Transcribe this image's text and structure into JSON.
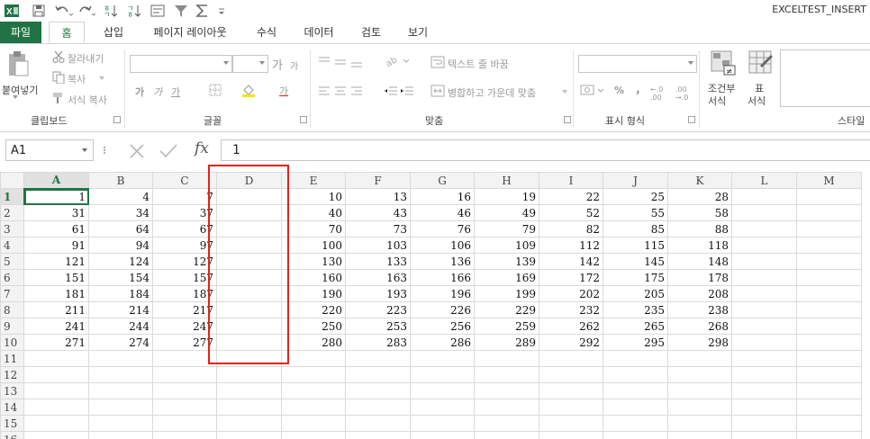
{
  "window": {
    "title": "EXCELTEST_INSERT"
  },
  "quick_access": {
    "icons": [
      "excel-logo-icon",
      "save-icon",
      "undo-icon",
      "redo-icon",
      "sort-ascending-icon",
      "sort-descending-icon",
      "form-icon",
      "filter-icon",
      "autosum-icon",
      "customize-icon"
    ]
  },
  "tabs": [
    {
      "label": "파일"
    },
    {
      "label": "홈"
    },
    {
      "label": "삽입"
    },
    {
      "label": "페이지 레이아웃"
    },
    {
      "label": "수식"
    },
    {
      "label": "데이터"
    },
    {
      "label": "검토"
    },
    {
      "label": "보기"
    }
  ],
  "ribbon": {
    "clipboard": {
      "paste": "붙여넣기",
      "cut": "잘라내기",
      "copy": "복사",
      "format_painter": "서식 복사",
      "label": "클립보드"
    },
    "font": {
      "grow": "가",
      "shrink": "가",
      "bold": "가",
      "italic": "가",
      "underline": "가",
      "color_a": "가",
      "label": "글꼴"
    },
    "alignment": {
      "wrap_text": "텍스트 줄 바꿈",
      "merge_center": "병합하고 가운데 맞춤",
      "label": "맞춤"
    },
    "number": {
      "percent": "%",
      "comma": ",",
      "inc_decimal": "←.0 .00",
      "dec_decimal": ".00 →.0",
      "label": "표시 형식"
    },
    "styles": {
      "conditional": "조건부",
      "conditional2": "서식",
      "table": "표",
      "table2": "서식",
      "label": "스타일"
    }
  },
  "formula_bar": {
    "name_box": "A1",
    "fx": "fx",
    "value": "1"
  },
  "sheet": {
    "columns": [
      "A",
      "B",
      "C",
      "D",
      "E",
      "F",
      "G",
      "H",
      "I",
      "J",
      "K",
      "L",
      "M"
    ],
    "rows": [
      {
        "n": "1",
        "cells": [
          "1",
          "4",
          "7",
          "",
          "10",
          "13",
          "16",
          "19",
          "22",
          "25",
          "28",
          "",
          ""
        ]
      },
      {
        "n": "2",
        "cells": [
          "31",
          "34",
          "37",
          "",
          "40",
          "43",
          "46",
          "49",
          "52",
          "55",
          "58",
          "",
          ""
        ]
      },
      {
        "n": "3",
        "cells": [
          "61",
          "64",
          "67",
          "",
          "70",
          "73",
          "76",
          "79",
          "82",
          "85",
          "88",
          "",
          ""
        ]
      },
      {
        "n": "4",
        "cells": [
          "91",
          "94",
          "97",
          "",
          "100",
          "103",
          "106",
          "109",
          "112",
          "115",
          "118",
          "",
          ""
        ]
      },
      {
        "n": "5",
        "cells": [
          "121",
          "124",
          "127",
          "",
          "130",
          "133",
          "136",
          "139",
          "142",
          "145",
          "148",
          "",
          ""
        ]
      },
      {
        "n": "6",
        "cells": [
          "151",
          "154",
          "157",
          "",
          "160",
          "163",
          "166",
          "169",
          "172",
          "175",
          "178",
          "",
          ""
        ]
      },
      {
        "n": "7",
        "cells": [
          "181",
          "184",
          "187",
          "",
          "190",
          "193",
          "196",
          "199",
          "202",
          "205",
          "208",
          "",
          ""
        ]
      },
      {
        "n": "8",
        "cells": [
          "211",
          "214",
          "217",
          "",
          "220",
          "223",
          "226",
          "229",
          "232",
          "235",
          "238",
          "",
          ""
        ]
      },
      {
        "n": "9",
        "cells": [
          "241",
          "244",
          "247",
          "",
          "250",
          "253",
          "256",
          "259",
          "262",
          "265",
          "268",
          "",
          ""
        ]
      },
      {
        "n": "10",
        "cells": [
          "271",
          "274",
          "277",
          "",
          "280",
          "283",
          "286",
          "289",
          "292",
          "295",
          "298",
          "",
          ""
        ]
      },
      {
        "n": "11",
        "cells": [
          "",
          "",
          "",
          "",
          "",
          "",
          "",
          "",
          "",
          "",
          "",
          "",
          ""
        ]
      },
      {
        "n": "12",
        "cells": [
          "",
          "",
          "",
          "",
          "",
          "",
          "",
          "",
          "",
          "",
          "",
          "",
          ""
        ]
      },
      {
        "n": "13",
        "cells": [
          "",
          "",
          "",
          "",
          "",
          "",
          "",
          "",
          "",
          "",
          "",
          "",
          ""
        ]
      },
      {
        "n": "14",
        "cells": [
          "",
          "",
          "",
          "",
          "",
          "",
          "",
          "",
          "",
          "",
          "",
          "",
          ""
        ]
      },
      {
        "n": "15",
        "cells": [
          "",
          "",
          "",
          "",
          "",
          "",
          "",
          "",
          "",
          "",
          "",
          "",
          ""
        ]
      },
      {
        "n": "16",
        "cells": [
          "",
          "",
          "",
          "",
          "",
          "",
          "",
          "",
          "",
          "",
          "",
          "",
          ""
        ]
      }
    ]
  },
  "colors": {
    "excel_green": "#217346",
    "highlight_red": "#e0231c"
  }
}
